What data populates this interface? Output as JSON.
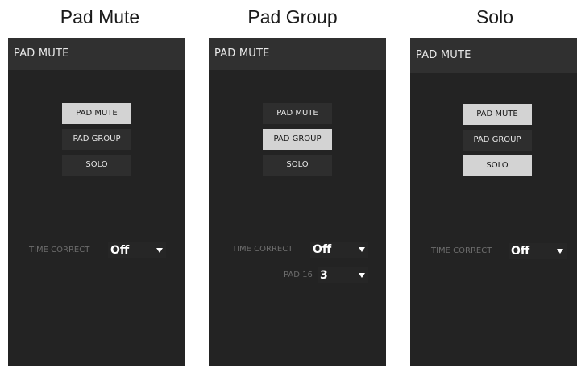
{
  "captions": [
    "Pad Mute",
    "Pad Group",
    "Solo"
  ],
  "panels": [
    {
      "header": "PAD MUTE",
      "buttons": [
        "PAD MUTE",
        "PAD GROUP",
        "SOLO"
      ],
      "active_button": "PAD MUTE",
      "time_correct_label": "TIME CORRECT",
      "time_correct_value": "Off"
    },
    {
      "header": "PAD MUTE",
      "buttons": [
        "PAD MUTE",
        "PAD GROUP",
        "SOLO"
      ],
      "active_button": "PAD GROUP",
      "time_correct_label": "TIME CORRECT",
      "time_correct_value": "Off",
      "pad_label": "PAD 16",
      "pad_group_value": "3"
    },
    {
      "header": "PAD MUTE",
      "buttons": [
        "PAD MUTE",
        "PAD GROUP",
        "SOLO"
      ],
      "active_button": "PAD MUTE, SOLO",
      "time_correct_label": "TIME CORRECT",
      "time_correct_value": "Off"
    }
  ],
  "icons": {
    "dropdown_arrow": "triangle-down-icon"
  },
  "colors": {
    "panel_bg": "#232323",
    "header_bg": "#303030",
    "button_bg": "#2e2e2e",
    "button_active_bg": "#d3d3d3"
  }
}
